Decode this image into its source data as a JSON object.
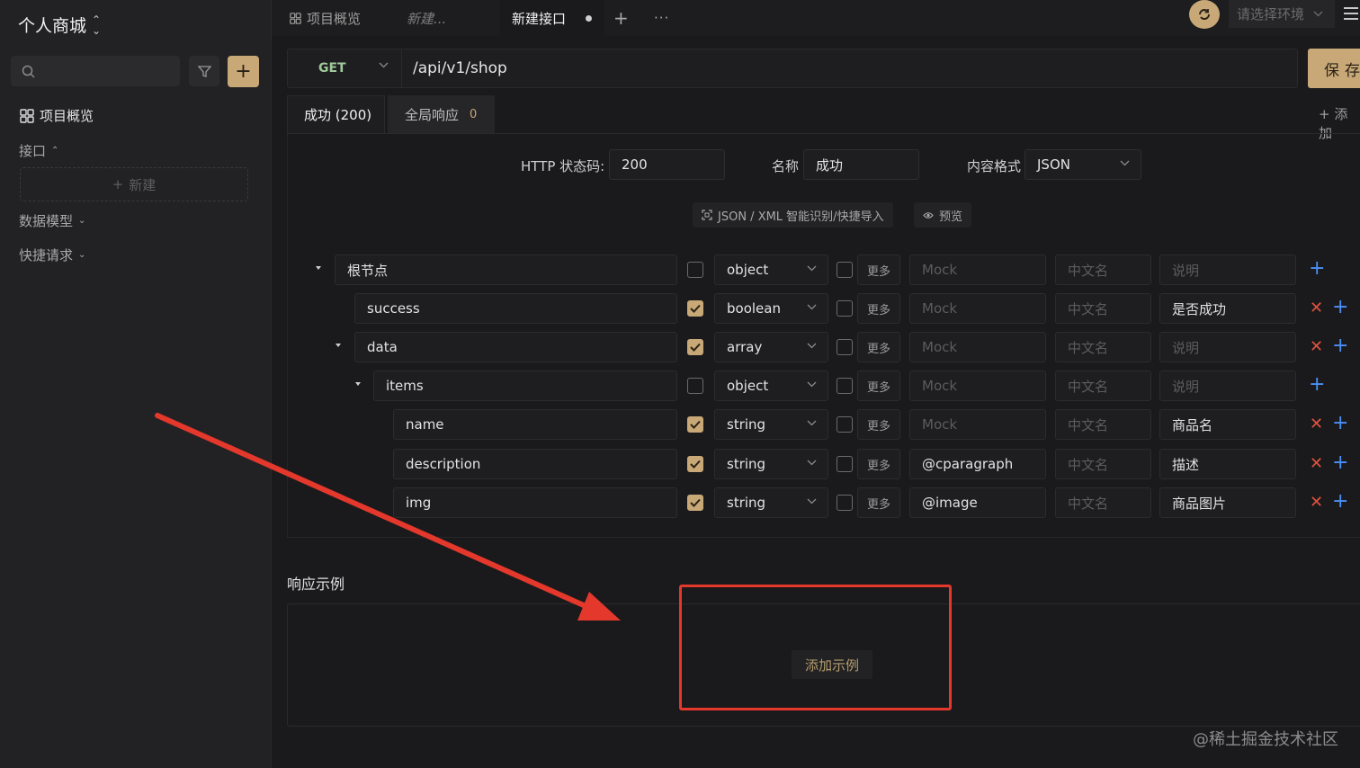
{
  "sidebar": {
    "project_title": "个人商城",
    "nav_overview": "项目概览",
    "section_api": "接口",
    "new_button": "新建",
    "section_models": "数据模型",
    "section_quick": "快捷请求"
  },
  "tabs": {
    "overview": "项目概览",
    "draft": "新建...",
    "active": "新建接口",
    "env_placeholder": "请选择环境"
  },
  "request": {
    "method": "GET",
    "url": "/api/v1/shop",
    "save_label": "保存"
  },
  "response_tabs": {
    "success": "成功 (200)",
    "global": "全局响应",
    "global_count": "0",
    "add": "+ 添加"
  },
  "form": {
    "status_label": "HTTP 状态码:",
    "status_value": "200",
    "name_label": "名称",
    "name_value": "成功",
    "format_label": "内容格式",
    "format_value": "JSON",
    "import_btn": "JSON / XML 智能识别/快捷导入",
    "preview_btn": "预览"
  },
  "tree_rows": [
    {
      "name": "根节点",
      "checked": false,
      "type": "object",
      "more": "更多",
      "mock": "Mock",
      "mock_ph": true,
      "cn": "中文名",
      "desc": "说明",
      "desc_ph": true,
      "deletable": false
    },
    {
      "name": "success",
      "checked": true,
      "type": "boolean",
      "more": "更多",
      "mock": "Mock",
      "mock_ph": true,
      "cn": "中文名",
      "desc": "是否成功",
      "desc_ph": false,
      "deletable": true
    },
    {
      "name": "data",
      "checked": true,
      "type": "array",
      "more": "更多",
      "mock": "Mock",
      "mock_ph": true,
      "cn": "中文名",
      "desc": "说明",
      "desc_ph": true,
      "deletable": true
    },
    {
      "name": "items",
      "checked": false,
      "type": "object",
      "more": "更多",
      "mock": "Mock",
      "mock_ph": true,
      "cn": "中文名",
      "desc": "说明",
      "desc_ph": true,
      "deletable": false
    },
    {
      "name": "name",
      "checked": true,
      "type": "string",
      "more": "更多",
      "mock": "Mock",
      "mock_ph": true,
      "cn": "中文名",
      "desc": "商品名",
      "desc_ph": false,
      "deletable": true
    },
    {
      "name": "description",
      "checked": true,
      "type": "string",
      "more": "更多",
      "mock": "@cparagraph",
      "mock_ph": false,
      "cn": "中文名",
      "desc": "描述",
      "desc_ph": false,
      "deletable": true
    },
    {
      "name": "img",
      "checked": true,
      "type": "string",
      "more": "更多",
      "mock": "@image",
      "mock_ph": false,
      "cn": "中文名",
      "desc": "商品图片",
      "desc_ph": false,
      "deletable": true
    }
  ],
  "example": {
    "title": "响应示例",
    "add_button": "添加示例"
  },
  "watermark": "@稀土掘金技术社区",
  "colors": {
    "accent": "#c8a877",
    "delete": "#e0533e",
    "add": "#4a8ff7",
    "annotation": "#e4382c"
  }
}
